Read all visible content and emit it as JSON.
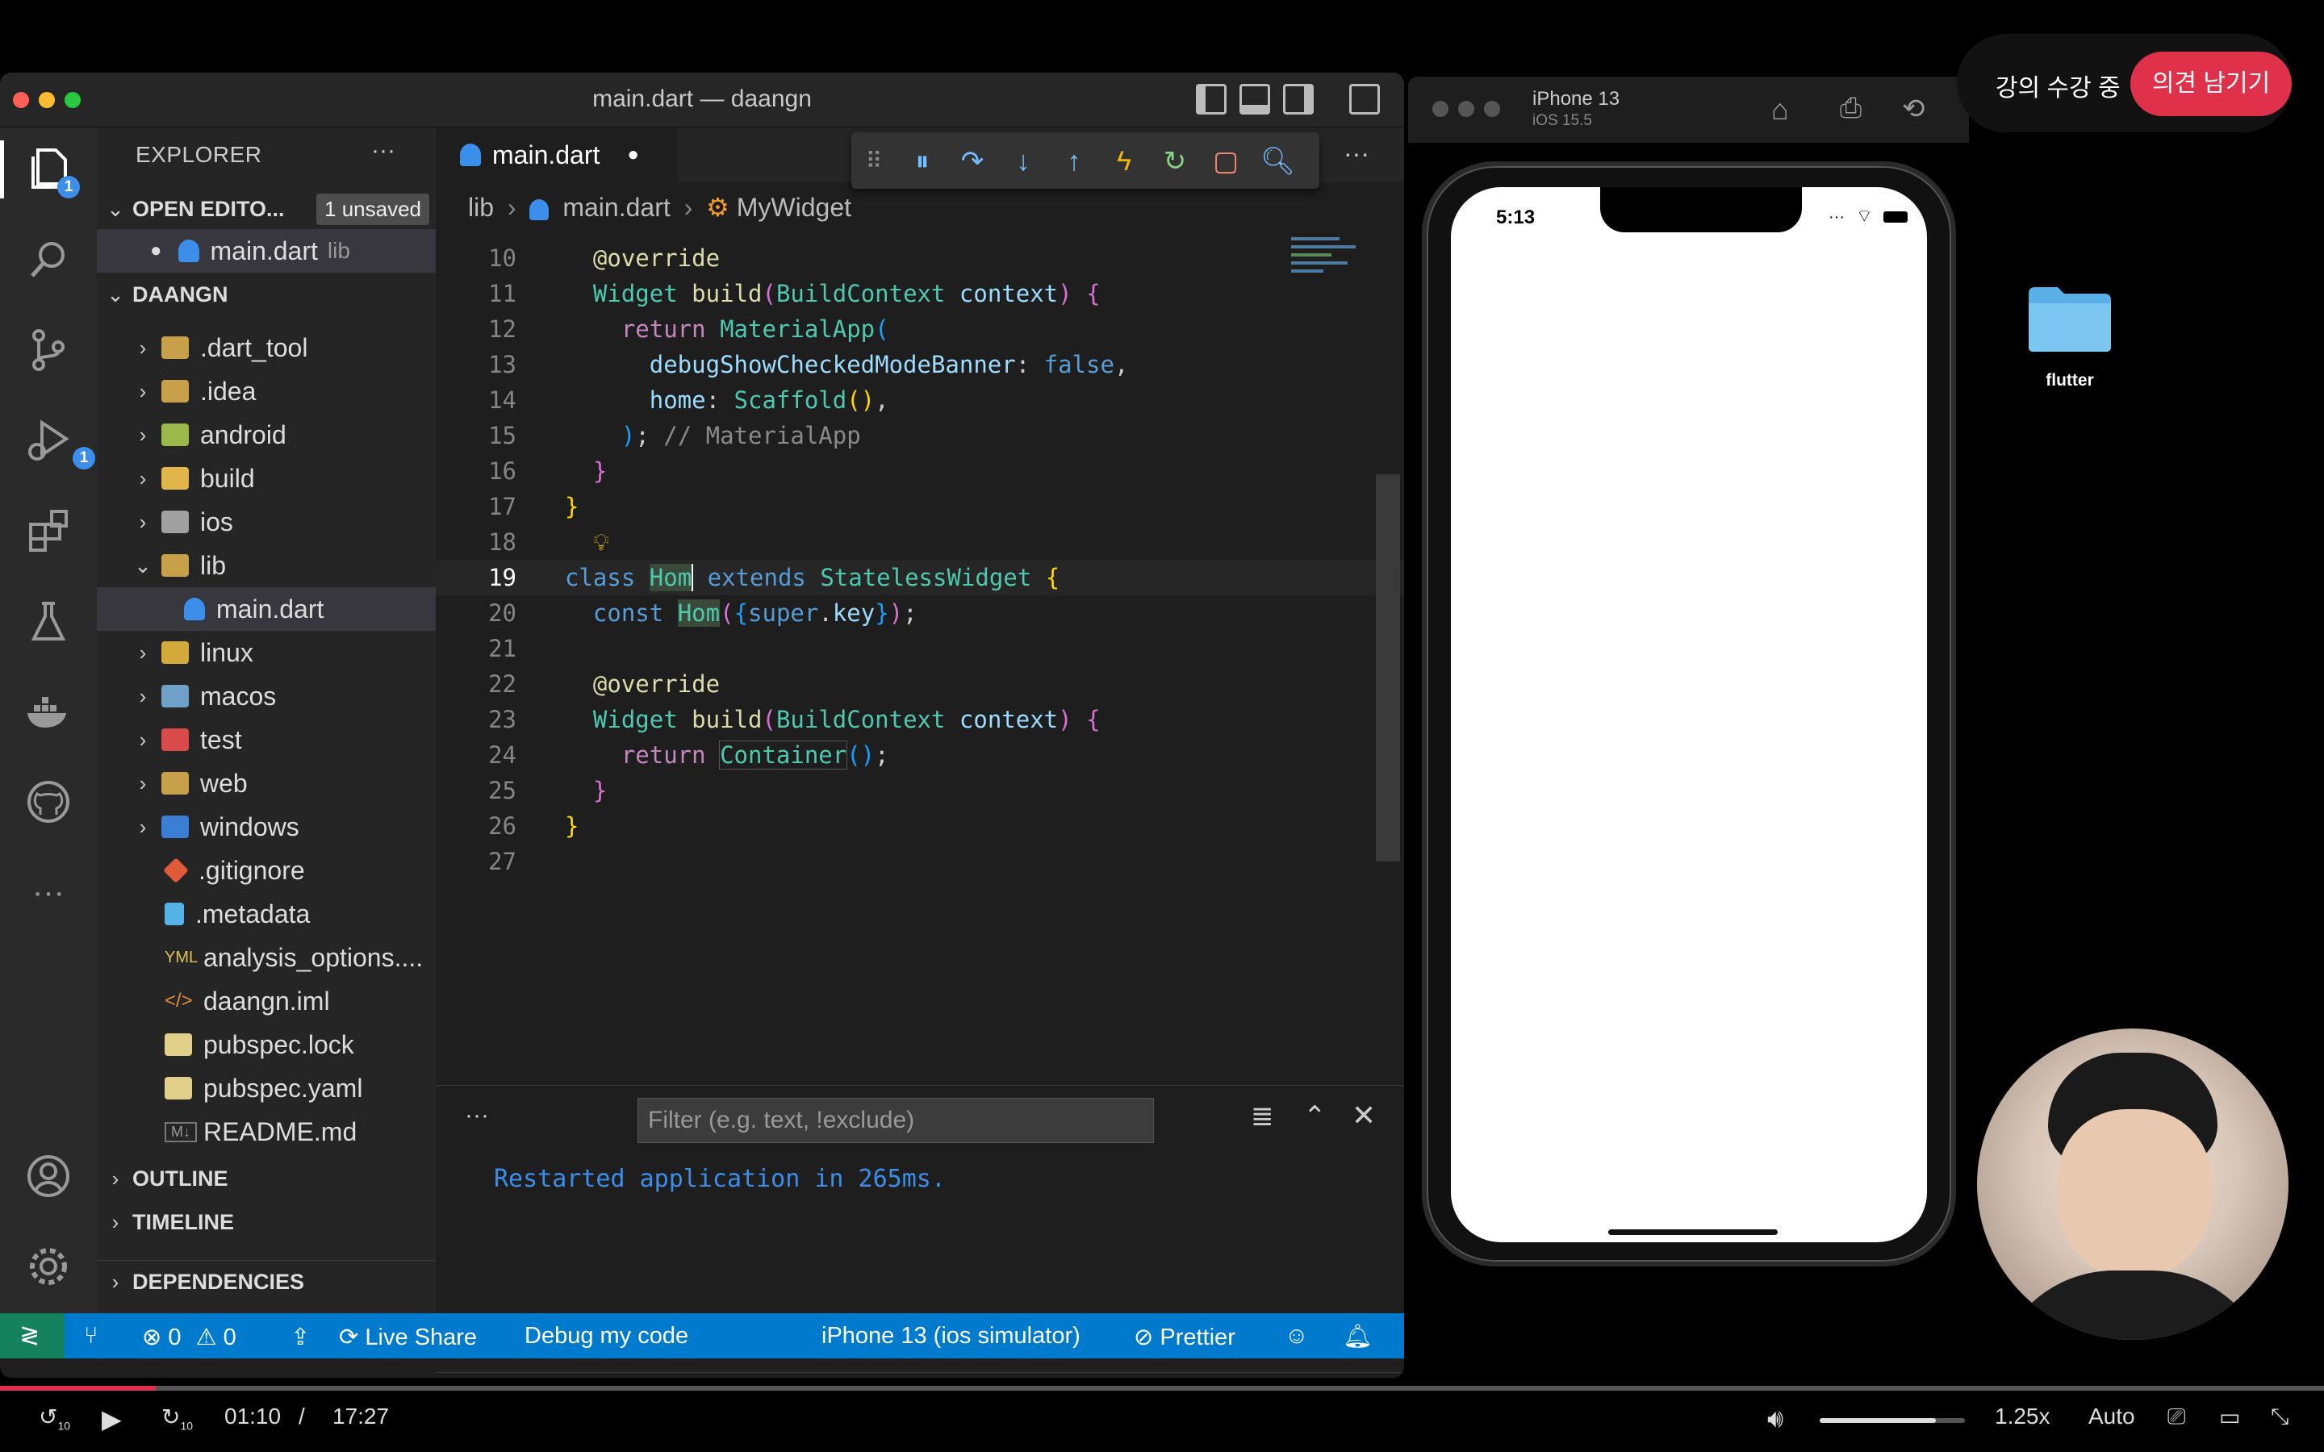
{
  "vscode": {
    "title": "main.dart — daangn",
    "sidebar": {
      "explorer_label": "EXPLORER",
      "more_label": "···",
      "open_editors_label": "OPEN EDITO...",
      "unsaved_badge": "1 unsaved",
      "open_editor_file": "main.dart",
      "open_editor_folder": "lib",
      "project_label": "DAANGN",
      "tree": [
        ".dart_tool",
        ".idea",
        "android",
        "build",
        "ios",
        "lib",
        "main.dart",
        "linux",
        "macos",
        "test",
        "web",
        "windows",
        ".gitignore",
        ".metadata",
        "analysis_options....",
        "daangn.iml",
        "pubspec.lock",
        "pubspec.yaml",
        "README.md"
      ],
      "outline_label": "OUTLINE",
      "timeline_label": "TIMELINE",
      "dependencies_label": "DEPENDENCIES"
    },
    "activity_badges": {
      "explorer": "1",
      "debug": "1"
    },
    "tab": {
      "name": "main.dart"
    },
    "breadcrumb": {
      "folder": "lib",
      "file": "main.dart",
      "symbol": "MyWidget"
    },
    "panel": {
      "more_label": "···",
      "filter_placeholder": "Filter (e.g. text, !exclude)",
      "message": "Restarted application in 265ms.",
      "prompt": "›"
    },
    "status": {
      "errors": "0",
      "warnings": "0",
      "live_share": "Live Share",
      "debug_code": "Debug my code",
      "device": "iPhone 13 (ios simulator)",
      "prettier": "Prettier"
    }
  },
  "simulator": {
    "device_name": "iPhone 13",
    "ios_version": "iOS 15.5",
    "time": "5:13"
  },
  "overlay": {
    "lecture_status": "강의 수강 중",
    "feedback_button": "의견 남기기",
    "folder_label": "flutter"
  },
  "video": {
    "current_time": "01:10",
    "separator": "/",
    "total_time": "17:27",
    "progress": 0.067,
    "speed": "1.25x",
    "quality": "Auto",
    "volume": 0.8,
    "rewind_label": "10",
    "forward_label": "10"
  },
  "colors": {
    "accent": "#007acc",
    "remote": "#16825d",
    "feedback": "#e0314b"
  }
}
